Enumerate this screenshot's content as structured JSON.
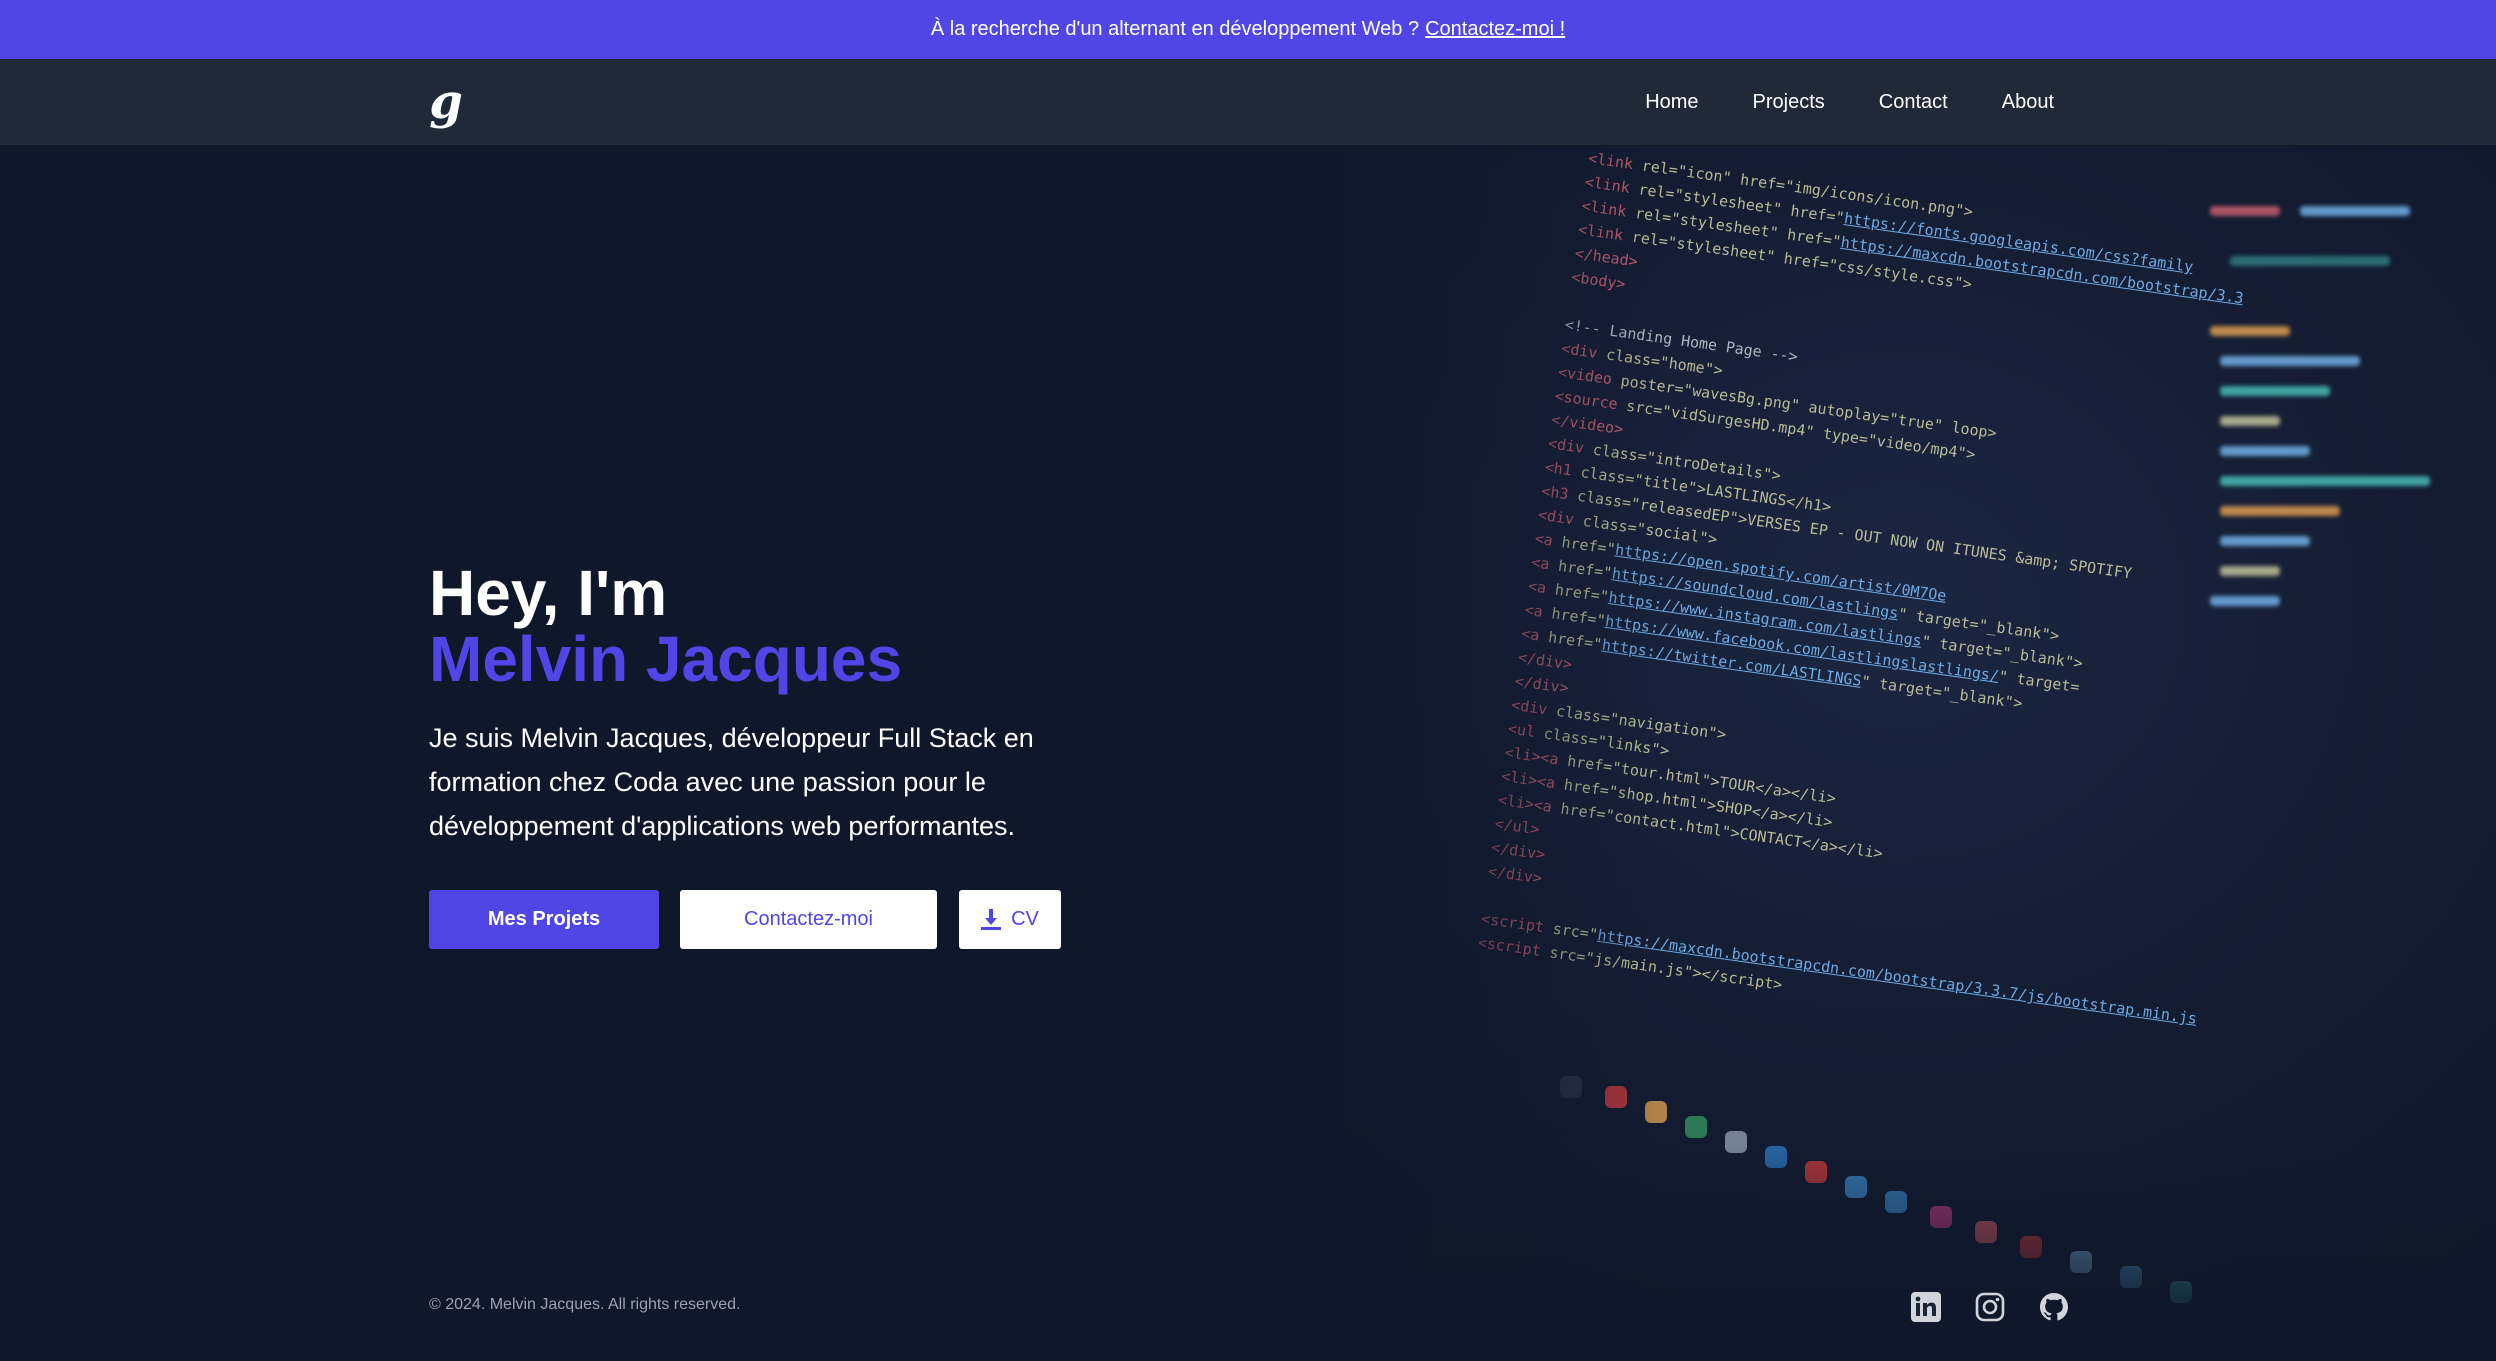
{
  "announcement": {
    "text": "À la recherche d'un alternant en développement Web ?",
    "link_label": "Contactez-moi !"
  },
  "nav": {
    "logo": "g",
    "links": [
      "Home",
      "Projects",
      "Contact",
      "About"
    ]
  },
  "hero": {
    "greeting": "Hey, I'm",
    "name": "Melvin Jacques",
    "bio": "Je suis Melvin Jacques, développeur Full Stack en formation chez Coda avec une passion pour le développement d'applications web performantes.",
    "buttons": {
      "projects": "Mes Projets",
      "contact": "Contactez-moi",
      "cv": "CV"
    }
  },
  "footer": {
    "copyright": "© 2024. Melvin Jacques. All rights reserved.",
    "socials": [
      "linkedin-icon",
      "instagram-icon",
      "github-icon"
    ]
  },
  "colors": {
    "accent": "#4f46e5",
    "background": "#0f172a",
    "navbar": "#1f2937"
  }
}
